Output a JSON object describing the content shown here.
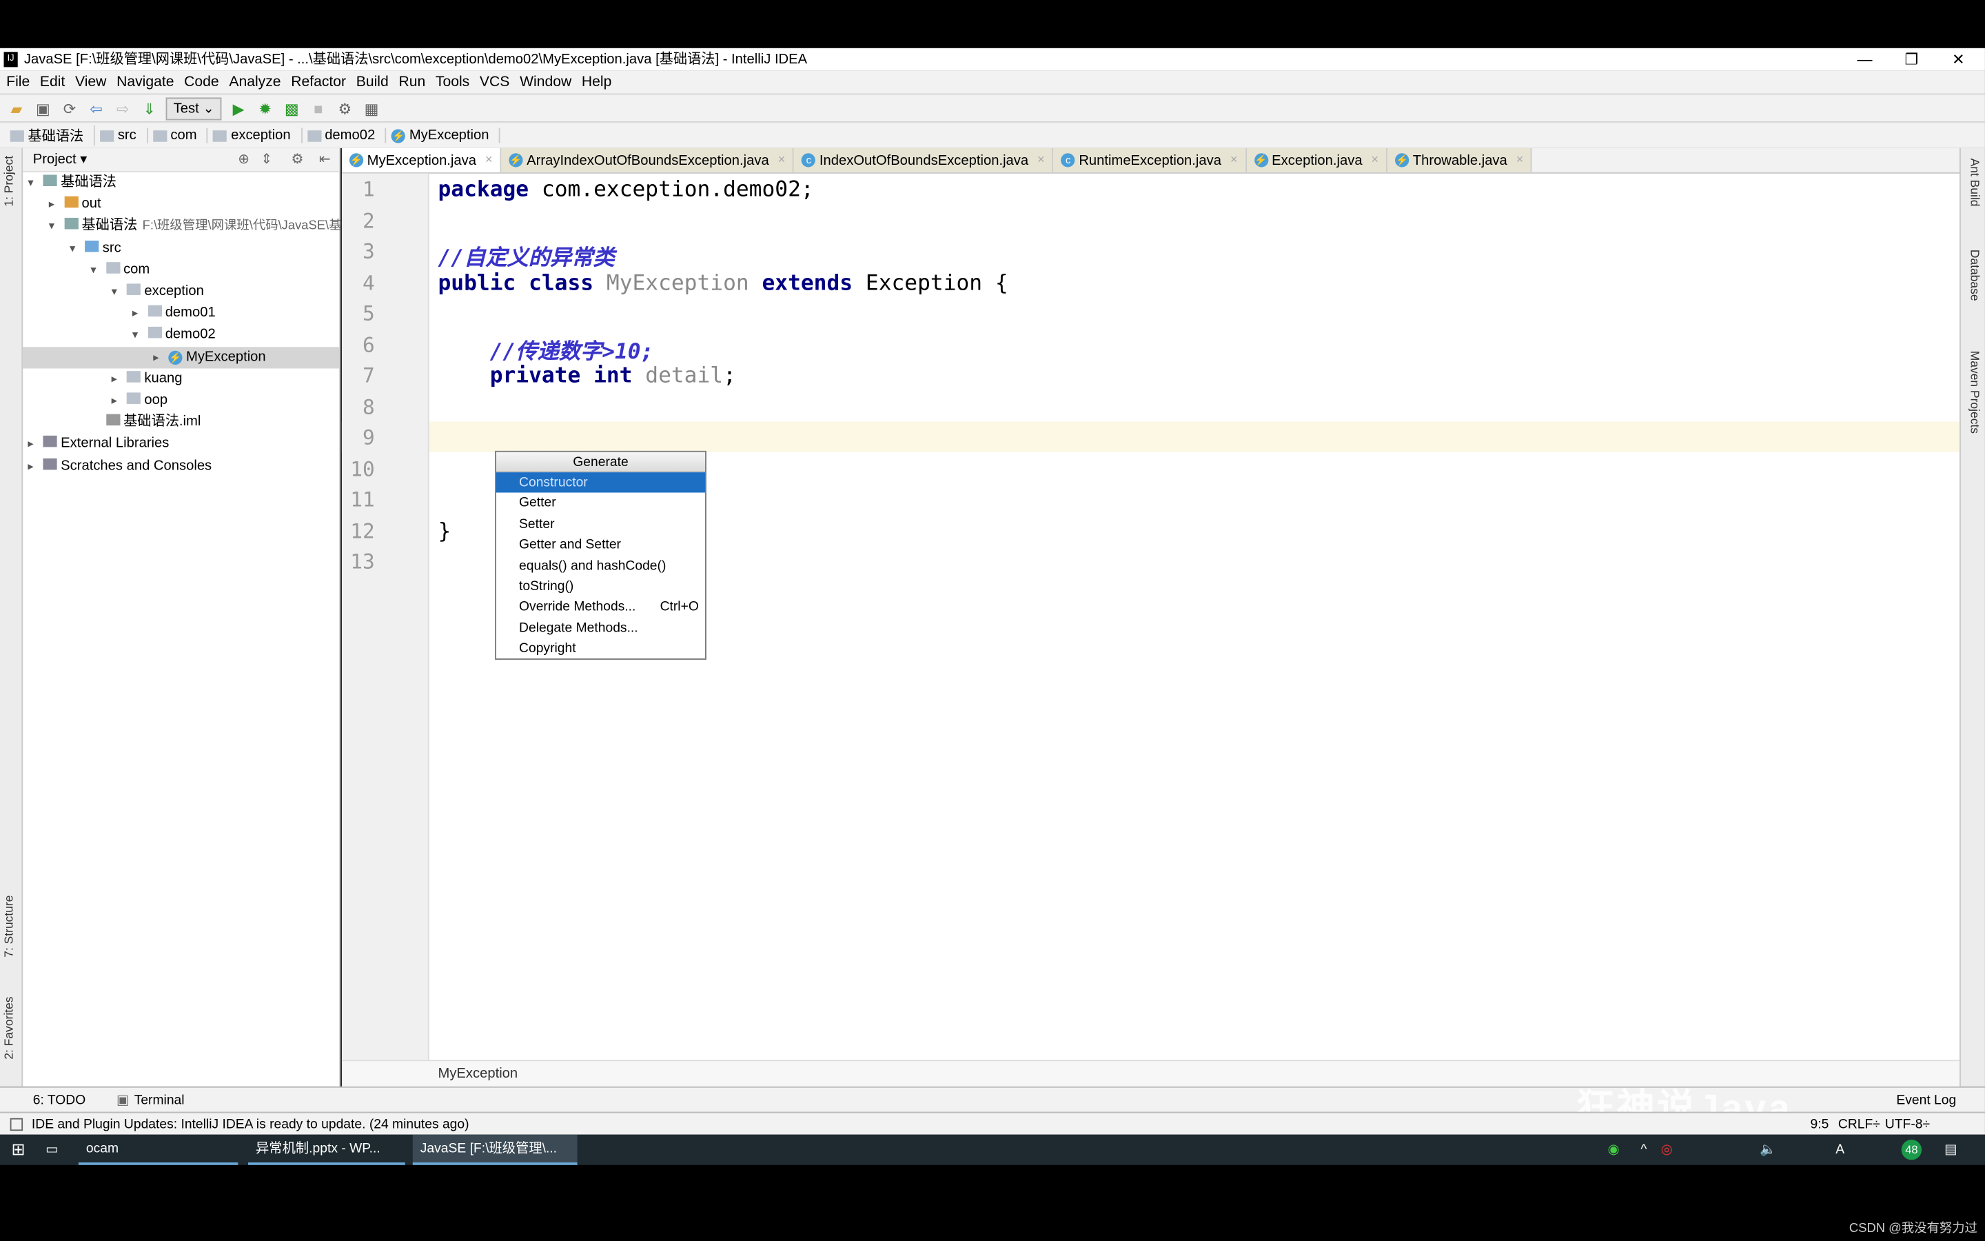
{
  "window": {
    "title": "JavaSE [F:\\班级管理\\网课班\\代码\\JavaSE] - ...\\基础语法\\src\\com\\exception\\demo02\\MyException.java [基础语法] - IntelliJ IDEA",
    "logo": "IJ",
    "minimize": "—",
    "maximize": "❐",
    "close": "✕"
  },
  "menu": [
    "File",
    "Edit",
    "View",
    "Navigate",
    "Code",
    "Analyze",
    "Refactor",
    "Build",
    "Run",
    "Tools",
    "VCS",
    "Window",
    "Help"
  ],
  "toolbar": {
    "run_config": "Test ⌄"
  },
  "breadcrumb": [
    "基础语法",
    "src",
    "com",
    "exception",
    "demo02",
    "MyException"
  ],
  "project": {
    "header": "Project ▾",
    "tree": [
      {
        "label": "基础语法",
        "depth": 0,
        "arrow": "▾",
        "type": "module"
      },
      {
        "label": "out",
        "depth": 1,
        "arrow": "▸",
        "type": "folder-orange"
      },
      {
        "label": "基础语法",
        "extra": "F:\\班级管理\\网课班\\代码\\JavaSE\\基",
        "depth": 1,
        "arrow": "▾",
        "type": "module"
      },
      {
        "label": "src",
        "depth": 2,
        "arrow": "▾",
        "type": "folder-blue"
      },
      {
        "label": "com",
        "depth": 3,
        "arrow": "▾",
        "type": "folder"
      },
      {
        "label": "exception",
        "depth": 4,
        "arrow": "▾",
        "type": "folder"
      },
      {
        "label": "demo01",
        "depth": 5,
        "arrow": "▸",
        "type": "folder"
      },
      {
        "label": "demo02",
        "depth": 5,
        "arrow": "▾",
        "type": "folder"
      },
      {
        "label": "MyException",
        "depth": 6,
        "arrow": "▸",
        "type": "class",
        "selected": true
      },
      {
        "label": "kuang",
        "depth": 4,
        "arrow": "▸",
        "type": "folder"
      },
      {
        "label": "oop",
        "depth": 4,
        "arrow": "▸",
        "type": "folder"
      },
      {
        "label": "基础语法.iml",
        "depth": 3,
        "arrow": "",
        "type": "file"
      },
      {
        "label": "External Libraries",
        "depth": 0,
        "arrow": "▸",
        "type": "lib"
      },
      {
        "label": "Scratches and Consoles",
        "depth": 0,
        "arrow": "▸",
        "type": "scratch"
      }
    ]
  },
  "tabs": [
    {
      "label": "MyException.java",
      "icon": "⚡",
      "active": true
    },
    {
      "label": "ArrayIndexOutOfBoundsException.java",
      "icon": "⚡"
    },
    {
      "label": "IndexOutOfBoundsException.java",
      "icon": "c"
    },
    {
      "label": "RuntimeException.java",
      "icon": "c"
    },
    {
      "label": "Exception.java",
      "icon": "⚡"
    },
    {
      "label": "Throwable.java",
      "icon": "⚡"
    }
  ],
  "editor": {
    "lines": [
      [
        {
          "t": "package",
          "c": "kw"
        },
        {
          "t": " com.exception.demo02;",
          "c": ""
        }
      ],
      [],
      [
        {
          "t": "//自定义的异常类",
          "c": "cm"
        }
      ],
      [
        {
          "t": "public class",
          "c": "kw"
        },
        {
          "t": " MyException ",
          "c": "gr"
        },
        {
          "t": "extends",
          "c": "kw"
        },
        {
          "t": " Exception {",
          "c": ""
        }
      ],
      [],
      [
        {
          "t": "    //传递数字>10;",
          "c": "cm"
        }
      ],
      [
        {
          "t": "    private int",
          "c": "kw"
        },
        {
          "t": " detail",
          "c": "gr"
        },
        {
          "t": ";",
          "c": ""
        }
      ],
      [],
      [],
      [],
      [],
      [
        {
          "t": "}",
          "c": ""
        }
      ],
      []
    ],
    "footer": "MyException"
  },
  "popup": {
    "title": "Generate",
    "items": [
      {
        "label": "Constructor",
        "selected": true
      },
      {
        "label": "Getter"
      },
      {
        "label": "Setter"
      },
      {
        "label": "Getter and Setter"
      },
      {
        "label": "equals() and hashCode()"
      },
      {
        "label": "toString()"
      },
      {
        "label": "Override Methods...",
        "shortcut": "Ctrl+O"
      },
      {
        "label": "Delegate Methods..."
      },
      {
        "label": "Copyright"
      }
    ]
  },
  "left_strip": [
    "1: Project",
    "7: Structure",
    "2: Favorites"
  ],
  "right_strip": [
    "Ant Build",
    "Database",
    "Maven Projects"
  ],
  "bottom_tools": {
    "todo": "6: TODO",
    "terminal": "Terminal",
    "event_log": "Event Log"
  },
  "status": {
    "message": "IDE and Plugin Updates: IntelliJ IDEA is ready to update. (24 minutes ago)",
    "position": "9:5",
    "line_sep": "CRLF÷",
    "encoding": "UTF-8÷"
  },
  "taskbar": {
    "apps": [
      "ocam",
      "异常机制.pptx - WP...",
      "JavaSE [F:\\班级管理\\..."
    ],
    "tray_badge": "48"
  },
  "watermark": "狂神说Java",
  "csdn": "CSDN @我没有努力过"
}
